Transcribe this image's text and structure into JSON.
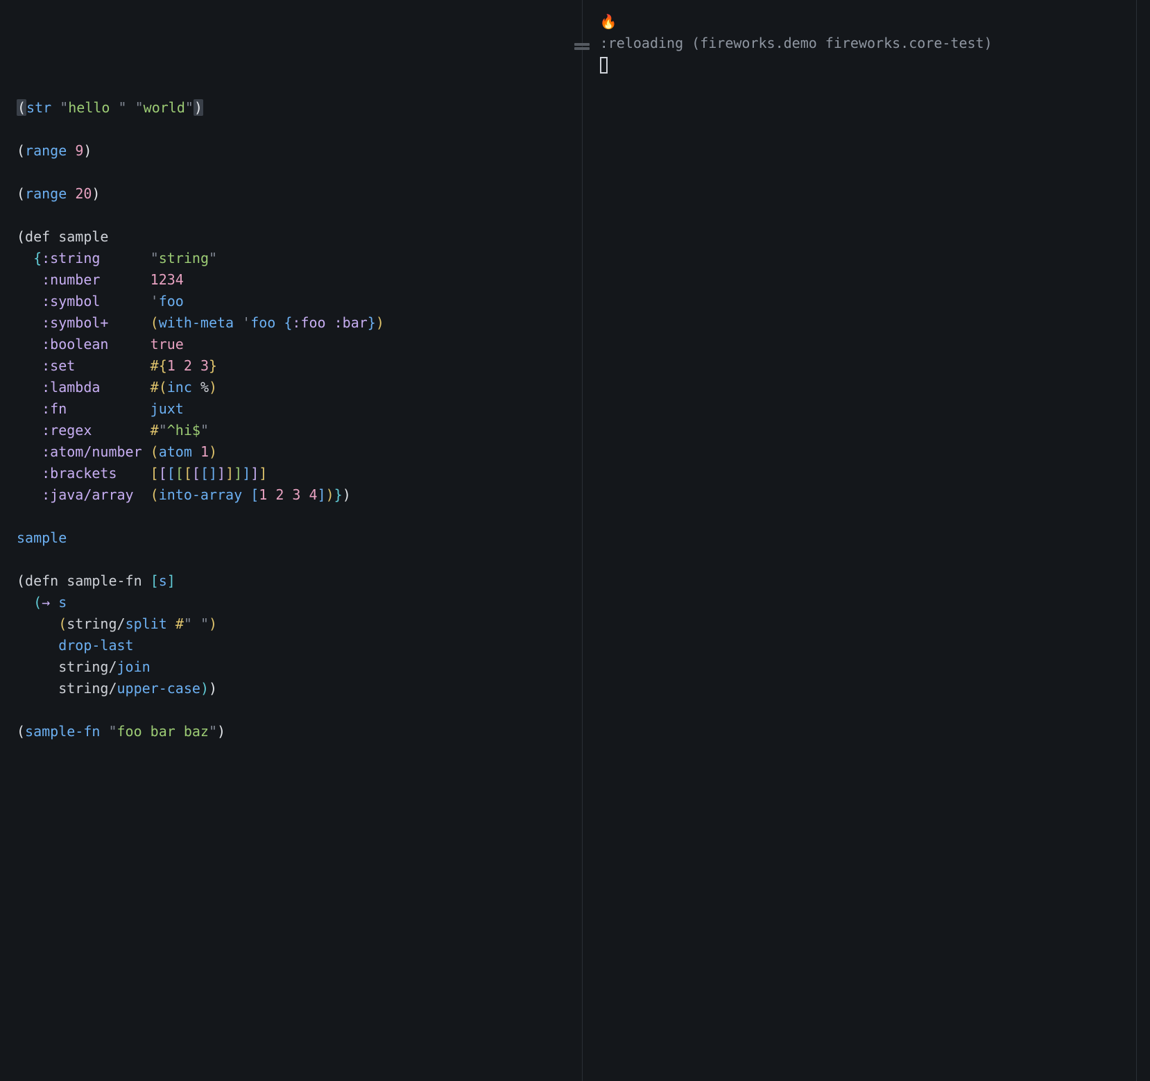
{
  "editor": {
    "blank_prelude_lines": 4,
    "line1": {
      "fn": "str",
      "arg1": "\"hello \"",
      "arg2": "\"world\""
    },
    "line2": {
      "fn": "range",
      "arg": "9"
    },
    "line3": {
      "fn": "range",
      "arg": "20"
    },
    "def": {
      "defkw": "def",
      "name": "sample",
      "entries": {
        "string": {
          "k": ":string",
          "v_str": "\"string\""
        },
        "number": {
          "k": ":number",
          "v_num": "1234"
        },
        "symbol": {
          "k": ":symbol",
          "quote": "'",
          "sym": "foo"
        },
        "symbolplus": {
          "k": ":symbol+",
          "fn": "with-meta",
          "quote": "'",
          "sym": "foo",
          "mk": ":foo",
          "mv": ":bar"
        },
        "boolean": {
          "k": ":boolean",
          "v_bool": "true"
        },
        "set": {
          "k": ":set",
          "hash": "#",
          "n1": "1",
          "n2": "2",
          "n3": "3"
        },
        "lambda": {
          "k": ":lambda",
          "hash": "#",
          "fn": "inc",
          "pct": "%"
        },
        "fn": {
          "k": ":fn",
          "sym": "juxt"
        },
        "regex": {
          "k": ":regex",
          "hash": "#",
          "pat": "\"^hi$\""
        },
        "atomnum": {
          "k": ":atom/number",
          "fn": "atom",
          "n": "1"
        },
        "brackets": {
          "k": ":brackets"
        },
        "javaarr": {
          "k": ":java/array",
          "fn": "into-array",
          "n1": "1",
          "n2": "2",
          "n3": "3",
          "n4": "4"
        }
      }
    },
    "sample_ref": "sample",
    "defn": {
      "kw": "defn",
      "name": "sample-fn",
      "param": "s",
      "thread": "→",
      "threadvar": "s",
      "split_ns": "string",
      "split_fn": "split",
      "split_hash": "#",
      "split_pat": "\" \"",
      "droplast": "drop-last",
      "join_ns": "string",
      "join_fn": "join",
      "upper_ns": "string",
      "upper_fn": "upper-case"
    },
    "call": {
      "fn": "sample-fn",
      "arg": "\"foo bar baz\""
    }
  },
  "repl": {
    "fire": "🔥",
    "line": ":reloading (fireworks.demo fireworks.core-test)"
  }
}
